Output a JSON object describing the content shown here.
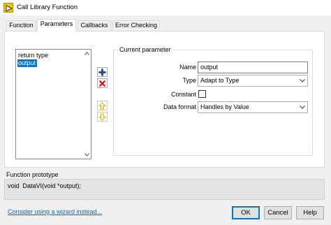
{
  "window": {
    "title": "Call Library Function"
  },
  "tabs": [
    {
      "label": "Function"
    },
    {
      "label": "Parameters"
    },
    {
      "label": "Callbacks"
    },
    {
      "label": "Error Checking"
    }
  ],
  "parameters_list": {
    "items": [
      "return type",
      "output"
    ],
    "selected_index": 1
  },
  "current_parameter": {
    "legend": "Current parameter",
    "name_label": "Name",
    "name_value": "output",
    "type_label": "Type",
    "type_value": "Adapt to Type",
    "constant_label": "Constant",
    "constant_checked": false,
    "data_format_label": "Data format",
    "data_format_value": "Handles by Value"
  },
  "prototype": {
    "label": "Function prototype",
    "text": "void  DataVI(void *output);"
  },
  "footer": {
    "wizard_link": "Consider using a wizard instead...",
    "ok_label": "OK",
    "cancel_label": "Cancel",
    "help_label": "Help"
  },
  "colors": {
    "selection": "#0078d7",
    "add_icon": "#1a4fa3",
    "remove_icon": "#d01010",
    "link": "#0066cc",
    "app_icon": "#f5c400"
  },
  "icons": {
    "app": "labview-function-icon",
    "add": "plus-icon",
    "remove": "x-icon",
    "move_up": "arrow-up-icon",
    "move_down": "arrow-down-icon"
  }
}
